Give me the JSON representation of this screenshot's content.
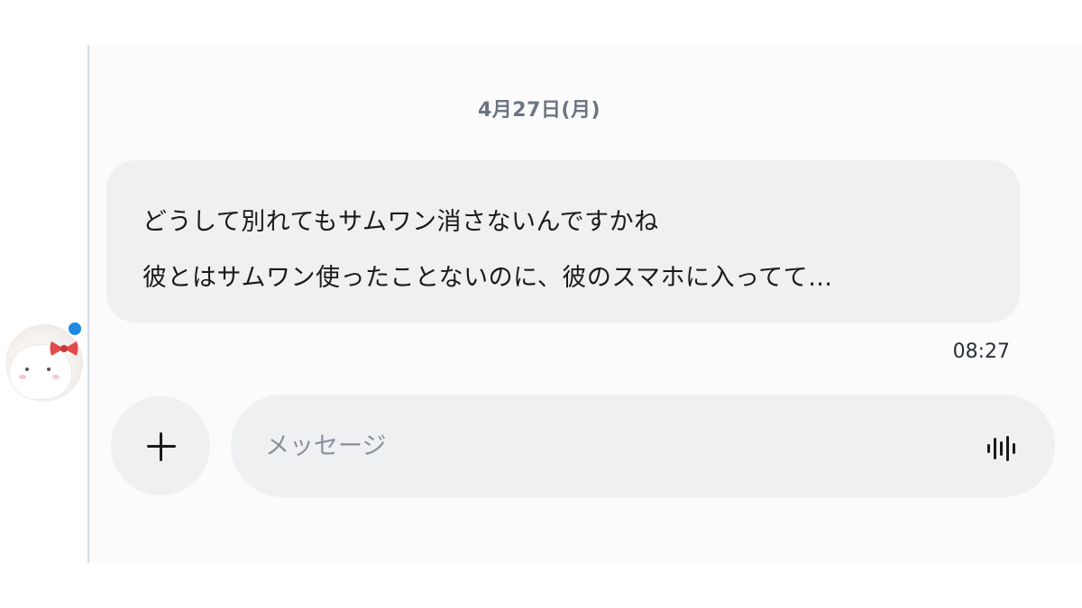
{
  "chat": {
    "date_label": "4月27日(月)",
    "message": {
      "lines": [
        "どうして別れてもサムワン消さないんですかね",
        "彼とはサムワン使ったことないのに、彼のスマホに入ってて…"
      ],
      "time": "08:27"
    }
  },
  "composer": {
    "add_icon": "plus-icon",
    "placeholder": "メッセージ",
    "voice_icon": "waveform-icon"
  },
  "colors": {
    "bubble_bg": "#eef0f2",
    "online_indicator": "#1e88e5",
    "date_text": "#6c7480"
  }
}
